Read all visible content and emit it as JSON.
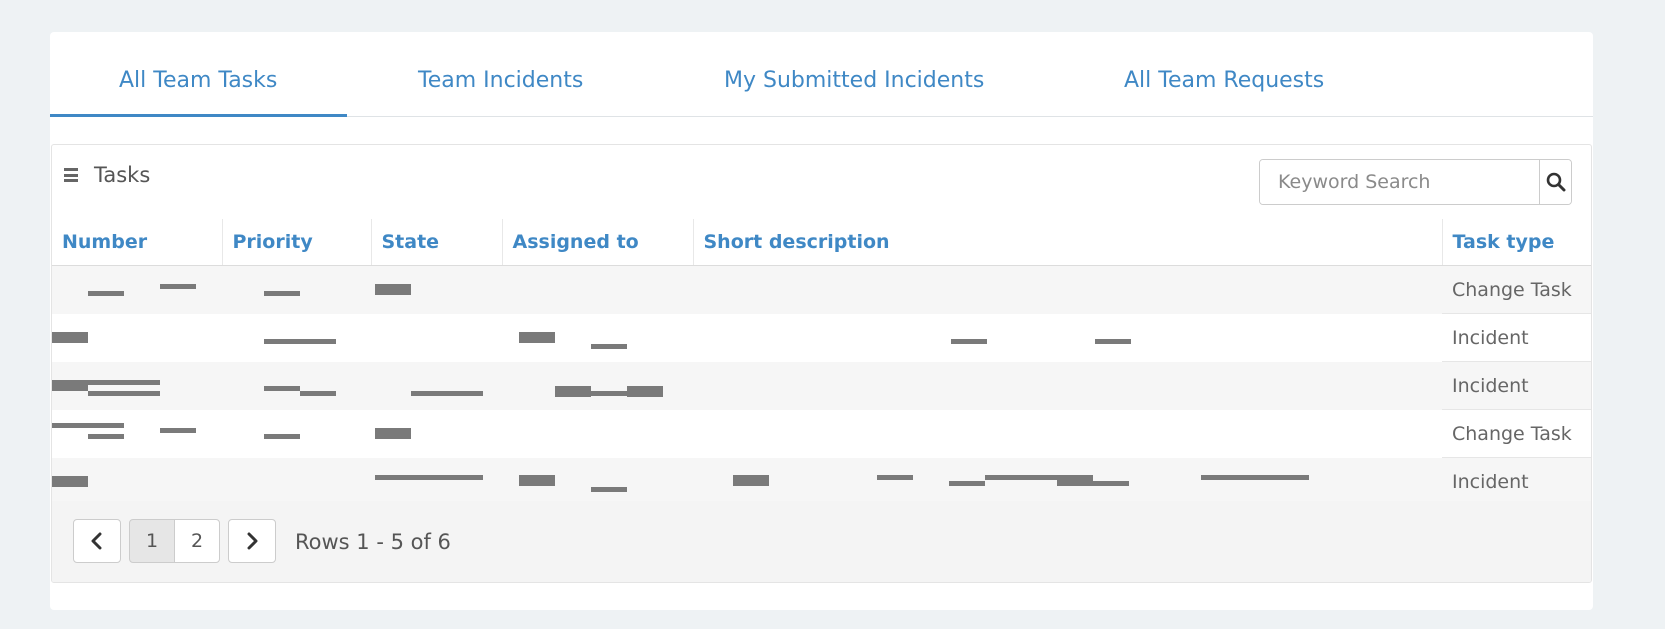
{
  "tabs": [
    {
      "label": "All Team Tasks",
      "active": true
    },
    {
      "label": "Team Incidents",
      "active": false
    },
    {
      "label": "My Submitted Incidents",
      "active": false
    },
    {
      "label": "All Team Requests",
      "active": false
    }
  ],
  "panel": {
    "title": "Tasks",
    "search_placeholder": "Keyword Search"
  },
  "table": {
    "columns": [
      "Number",
      "Priority",
      "State",
      "Assigned to",
      "Short description",
      "Task type"
    ],
    "rows": [
      {
        "task_type": "Change Task"
      },
      {
        "task_type": "Incident"
      },
      {
        "task_type": "Incident"
      },
      {
        "task_type": "Change Task"
      },
      {
        "task_type": "Incident"
      }
    ]
  },
  "pagination": {
    "pages": [
      "1",
      "2"
    ],
    "current_page": "1",
    "rows_info": "Rows 1 - 5 of 6"
  },
  "colors": {
    "accent": "#3f88c5",
    "background": "#eef2f4"
  }
}
